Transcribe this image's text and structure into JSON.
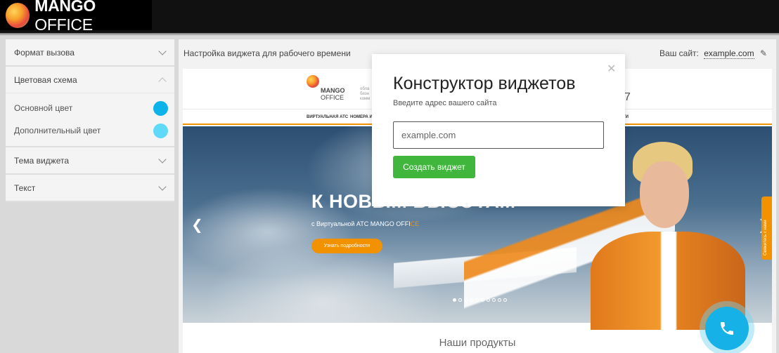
{
  "brand": {
    "name_bold": "MANGO",
    "name_light": " OFFICE"
  },
  "sidebar": {
    "sections": [
      {
        "label": "Формат вызова",
        "state": "collapsed"
      },
      {
        "label": "Цветовая схема",
        "state": "expanded"
      },
      {
        "label": "Тема виджета",
        "state": "collapsed"
      },
      {
        "label": "Текст",
        "state": "collapsed"
      }
    ],
    "colors": [
      {
        "label": "Основной цвет",
        "value": "#0cb3e8"
      },
      {
        "label": "Дополнительный цвет",
        "value": "#5fd9f7"
      }
    ]
  },
  "main": {
    "title": "Настройка виджета для рабочего времени",
    "site_label": "Ваш сайт:",
    "site_value": "example.com"
  },
  "preview": {
    "logo_bold": "MANGO",
    "logo_light": "OFFICE",
    "logo_tagline": "обла\nбизн\nкомм",
    "phone_fragment": "7",
    "nav": [
      "ВИРТУАЛЬНАЯ АТС",
      "НОМЕРА И ЛИН",
      "ТИ"
    ],
    "hero_title": "К НОВЫМ ВЫСОТАМ",
    "hero_subtitle_prefix": "с Виртуальной АТС MANGO OFFI",
    "hero_subtitle_accent": "CE",
    "hero_button": "Узнать подробности",
    "side_tab": "Свяжитесь с нами",
    "section_title": "Наши продукты",
    "accent_color": "#f39200"
  },
  "call_button": {
    "icon": "phone-icon",
    "color": "#16b1e7"
  },
  "modal": {
    "title": "Конструктор виджетов",
    "subtitle": "Введите адрес вашего сайта",
    "input_placeholder": "example.com",
    "input_value": "",
    "button_label": "Создать виджет",
    "close_icon": "close-icon",
    "button_color": "#41b63c"
  }
}
